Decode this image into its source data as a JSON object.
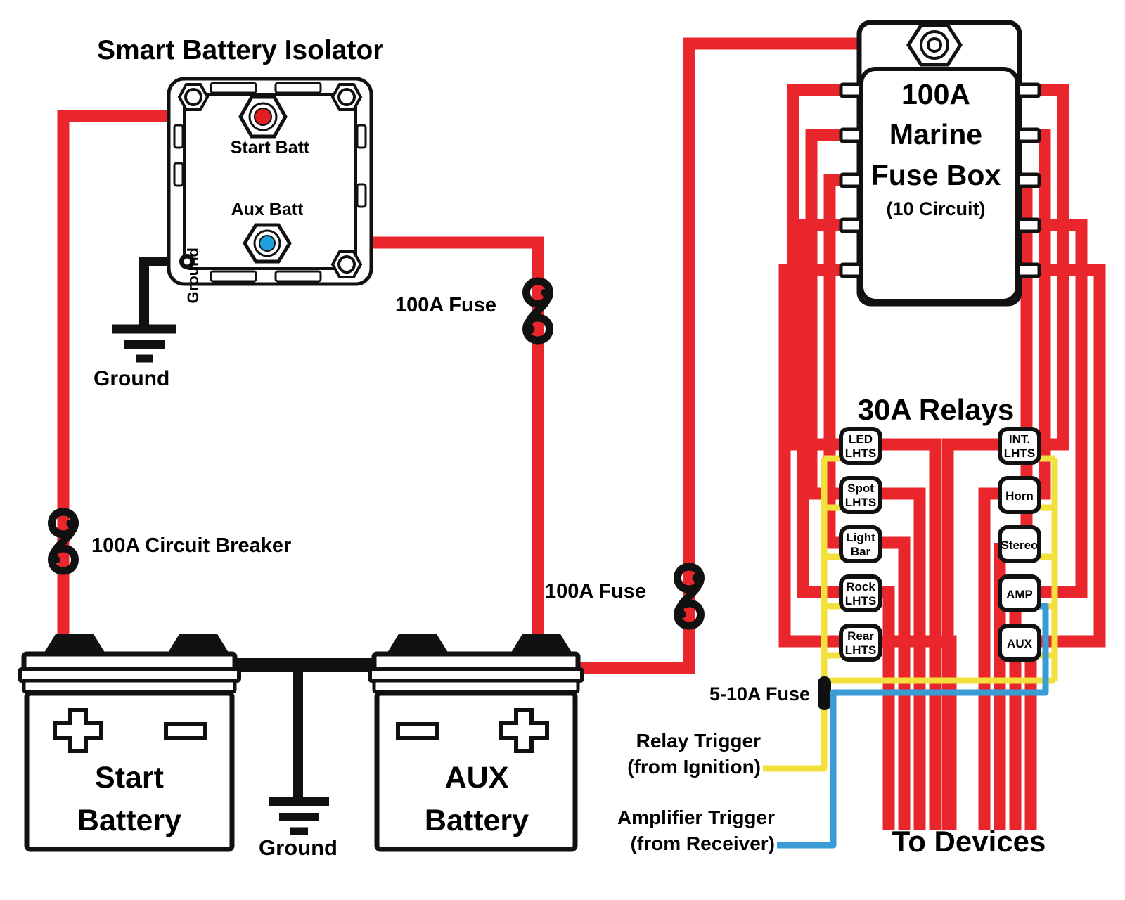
{
  "diagram": {
    "title": "Smart Battery Isolator",
    "colors": {
      "red_wire": "#E8262C",
      "black_wire": "#111111",
      "yellow_wire": "#F2E03C",
      "blue_wire": "#3A9BD5",
      "outline": "#000000",
      "background": "#FFFFFF",
      "terminal_red": "#E02020",
      "terminal_blue": "#1E9FE0"
    }
  },
  "isolator": {
    "title": "Smart Battery Isolator",
    "start_terminal_label": "Start Batt",
    "aux_terminal_label": "Aux Batt",
    "ground_terminal_label": "Ground",
    "ground_symbol_label": "Ground"
  },
  "batteries": [
    {
      "id": "start-battery",
      "name_line1": "Start",
      "name_line2": "Battery",
      "positive_marker": "+",
      "negative_marker": "–",
      "positive_side": "left",
      "negative_side": "right"
    },
    {
      "id": "aux-battery",
      "name_line1": "AUX",
      "name_line2": "Battery",
      "positive_marker": "+",
      "negative_marker": "–",
      "positive_side": "right",
      "negative_side": "left"
    }
  ],
  "battery_ground_label": "Ground",
  "protection": [
    {
      "id": "circuit-breaker",
      "label": "100A Circuit Breaker",
      "type": "circuit-breaker"
    },
    {
      "id": "fuse-isolator-out",
      "label": "100A Fuse",
      "type": "fuse"
    },
    {
      "id": "fuse-aux-out",
      "label": "100A Fuse",
      "type": "fuse"
    },
    {
      "id": "fuse-trigger",
      "label": "5-10A Fuse",
      "type": "fuse-inline"
    }
  ],
  "fuse_box": {
    "line1": "100A",
    "line2": "Marine",
    "line3": "Fuse Box",
    "line4": "(10 Circuit)",
    "circuits": 10,
    "terminals_left": 5,
    "terminals_right": 5,
    "main_terminal": "stud"
  },
  "relays": {
    "title": "30A Relays",
    "rating": "30A",
    "left_column": [
      {
        "line1": "LED",
        "line2": "LHTS"
      },
      {
        "line1": "Spot",
        "line2": "LHTS"
      },
      {
        "line1": "Light",
        "line2": "Bar"
      },
      {
        "line1": "Rock",
        "line2": "LHTS"
      },
      {
        "line1": "Rear",
        "line2": "LHTS"
      }
    ],
    "right_column": [
      {
        "line1": "INT.",
        "line2": "LHTS"
      },
      {
        "line1": "Horn",
        "line2": ""
      },
      {
        "line1": "Stereo",
        "line2": ""
      },
      {
        "line1": "AMP",
        "line2": ""
      },
      {
        "line1": "AUX",
        "line2": ""
      }
    ]
  },
  "triggers": [
    {
      "id": "relay-trigger",
      "line1": "Relay Trigger",
      "line2": "(from Ignition)",
      "color": "#F2E03C"
    },
    {
      "id": "amplifier-trigger",
      "line1": "Amplifier Trigger",
      "line2": "(from Receiver)",
      "color": "#3A9BD5"
    }
  ],
  "outputs": {
    "label": "To Devices",
    "bundle_count": 2,
    "wires_per_bundle": 5
  }
}
